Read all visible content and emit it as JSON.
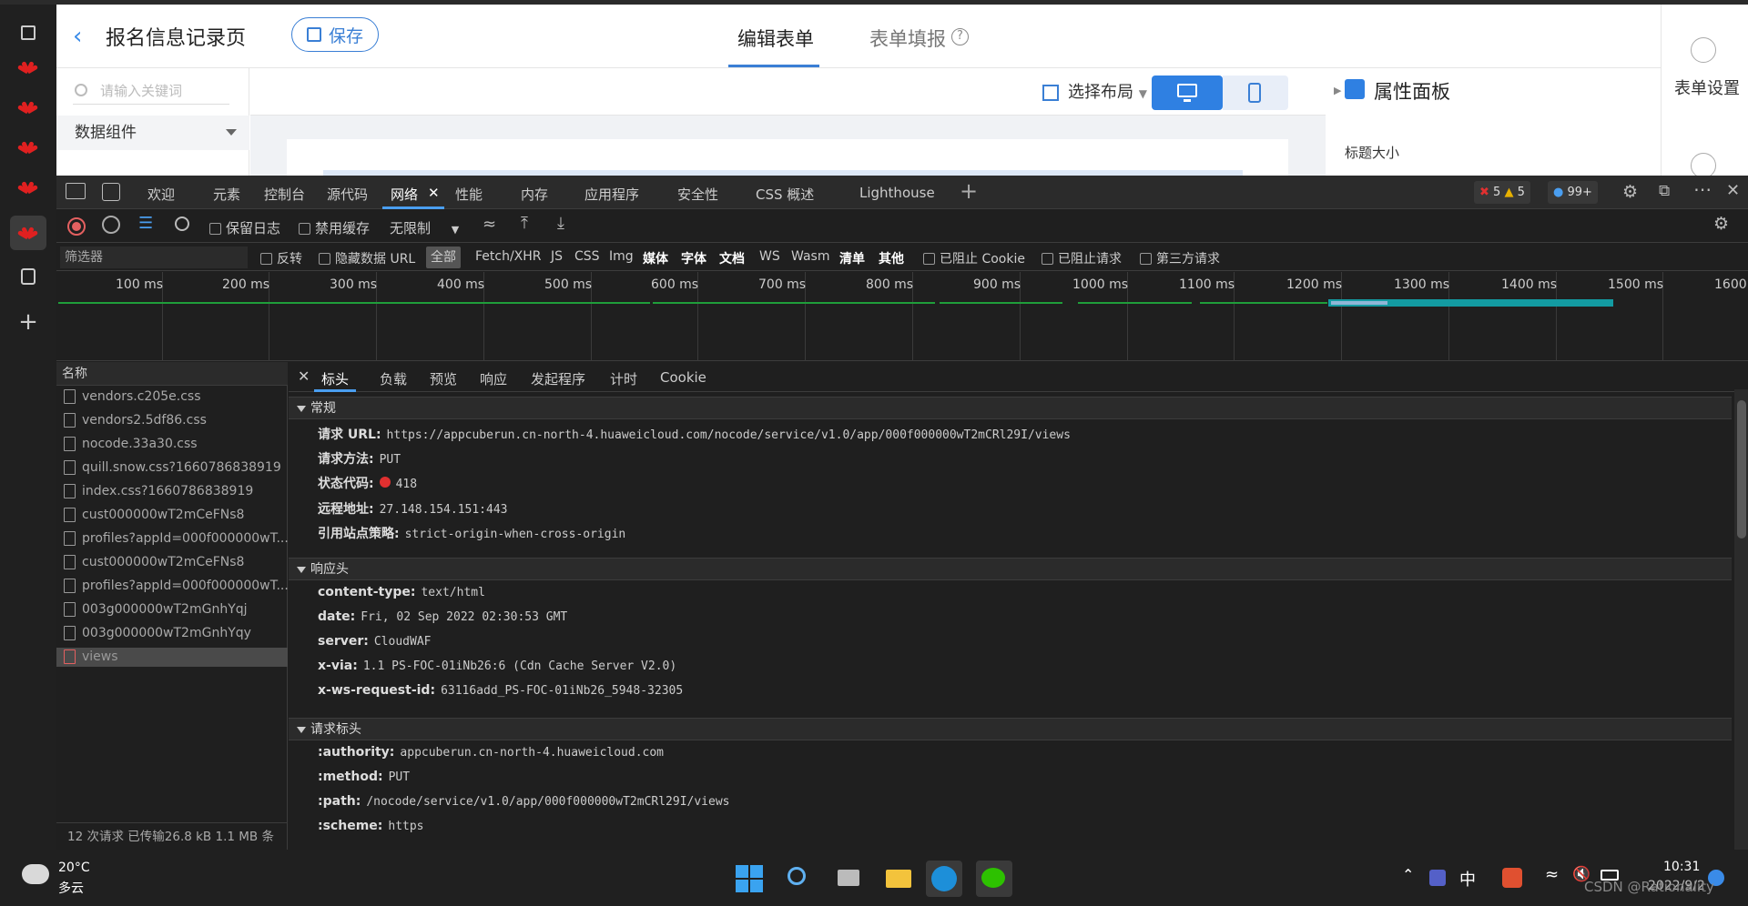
{
  "sidebar": {
    "icons": [
      "tabs-icon",
      "huawei-icon",
      "huawei-icon",
      "huawei-icon",
      "huawei-icon",
      "huawei-icon",
      "settings-icon",
      "add-icon"
    ]
  },
  "app": {
    "title": "报名信息记录页",
    "save_label": "保存",
    "tabs": [
      "编辑表单",
      "表单填报"
    ],
    "search_placeholder": "请输入关键词",
    "group_label": "数据组件",
    "layout_label": "选择布局",
    "prop_title": "属性面板",
    "prop_label": "标题大小",
    "form_settings": "表单设置"
  },
  "devtools": {
    "tabs": [
      "欢迎",
      "元素",
      "控制台",
      "源代码",
      "网络",
      "性能",
      "内存",
      "应用程序",
      "安全性",
      "CSS 概述",
      "Lighthouse"
    ],
    "errors": "5",
    "warnings": "5",
    "messages": "99+",
    "toolbar": {
      "preserve_log": "保留日志",
      "disable_cache": "禁用缓存",
      "throttle": "无限制"
    },
    "filter": {
      "placeholder": "筛选器",
      "invert": "反转",
      "hide_data_url": "隐藏数据 URL",
      "types": [
        "全部",
        "Fetch/XHR",
        "JS",
        "CSS",
        "Img",
        "媒体",
        "字体",
        "文档",
        "WS",
        "Wasm",
        "清单",
        "其他"
      ],
      "blocked_cookies": "已阻止 Cookie",
      "blocked_requests": "已阻止请求",
      "third_party": "第三方请求"
    },
    "timeline": [
      "100 ms",
      "200 ms",
      "300 ms",
      "400 ms",
      "500 ms",
      "600 ms",
      "700 ms",
      "800 ms",
      "900 ms",
      "1000 ms",
      "1100 ms",
      "1200 ms",
      "1300 ms",
      "1400 ms",
      "1500 ms",
      "1600"
    ],
    "list_header": "名称",
    "requests": [
      "vendors.c205e.css",
      "vendors2.5df86.css",
      "nocode.33a30.css",
      "quill.snow.css?1660786838919",
      "index.css?1660786838919",
      "cust000000wT2mCeFNs8",
      "profiles?appId=000f000000wT...",
      "cust000000wT2mCeFNs8",
      "profiles?appId=000f000000wT...",
      "003g000000wT2mGnhYqj",
      "003g000000wT2mGnhYqy",
      "views"
    ],
    "footer": "12 次请求  已传输26.8 kB  1.1 MB 条",
    "detail_tabs": [
      "标头",
      "负载",
      "预览",
      "响应",
      "发起程序",
      "计时",
      "Cookie"
    ],
    "general": {
      "title": "常规",
      "rows": [
        {
          "k": "请求 URL:",
          "v": "https://appcuberun.cn-north-4.huaweicloud.com/nocode/service/v1.0/app/000f000000wT2mCRl29I/views"
        },
        {
          "k": "请求方法:",
          "v": "PUT"
        },
        {
          "k": "状态代码:",
          "v": "418"
        },
        {
          "k": "远程地址:",
          "v": "27.148.154.151:443"
        },
        {
          "k": "引用站点策略:",
          "v": "strict-origin-when-cross-origin"
        }
      ]
    },
    "response_headers": {
      "title": "响应头",
      "rows": [
        {
          "k": "content-type:",
          "v": "text/html"
        },
        {
          "k": "date:",
          "v": "Fri, 02 Sep 2022 02:30:53 GMT"
        },
        {
          "k": "server:",
          "v": "CloudWAF"
        },
        {
          "k": "x-via:",
          "v": "1.1 PS-FOC-01iNb26:6 (Cdn Cache Server V2.0)"
        },
        {
          "k": "x-ws-request-id:",
          "v": "63116add_PS-FOC-01iNb26_5948-32305"
        }
      ]
    },
    "request_headers": {
      "title": "请求标头",
      "rows": [
        {
          "k": ":authority:",
          "v": "appcuberun.cn-north-4.huaweicloud.com"
        },
        {
          "k": ":method:",
          "v": "PUT"
        },
        {
          "k": ":path:",
          "v": "/nocode/service/v1.0/app/000f000000wT2mCRl29I/views"
        },
        {
          "k": ":scheme:",
          "v": "https"
        }
      ]
    }
  },
  "taskbar": {
    "temp": "20°C",
    "weather": "多云",
    "ime": "中",
    "time": "10:31",
    "date": "2022/9/2",
    "watermark": "CSDN @Rationality"
  },
  "colors": {
    "accent": "#3a7fd5",
    "devtools_bg": "#1f1f1f",
    "error": "#e03030",
    "timeline_green": "#1f9e3a"
  }
}
